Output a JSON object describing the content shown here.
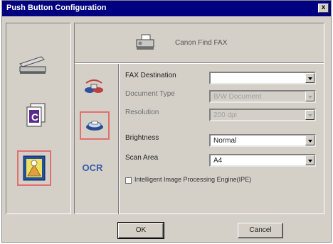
{
  "window": {
    "title": "Push Button Configuration",
    "close_label": "x"
  },
  "header": {
    "label": "Canon Find FAX",
    "icon": "fax-printer-icon"
  },
  "sidebar": {
    "items": [
      {
        "name": "scanner",
        "icon": "scanner-icon",
        "selected": false
      },
      {
        "name": "copy",
        "icon": "copy-document-icon",
        "selected": false
      },
      {
        "name": "photo",
        "icon": "photo-frame-icon",
        "selected": true
      }
    ]
  },
  "functions": {
    "items": [
      {
        "name": "email",
        "icon": "email-icon",
        "selected": false
      },
      {
        "name": "fax",
        "icon": "fax-icon",
        "selected": true
      },
      {
        "name": "ocr",
        "label": "OCR",
        "selected": false
      }
    ]
  },
  "form": {
    "fax_destination": {
      "label": "FAX Destination",
      "value": ""
    },
    "document_type": {
      "label": "Document Type",
      "value": "B/W Document",
      "disabled": true
    },
    "resolution": {
      "label": "Resolution",
      "value": "200 dpi",
      "disabled": true
    },
    "brightness": {
      "label": "Brightness",
      "value": "Normal"
    },
    "scan_area": {
      "label": "Scan Area",
      "value": "A4"
    },
    "ipe_checkbox": {
      "label": "Intelligent Image Processing Engine(IPE)",
      "checked": false
    }
  },
  "buttons": {
    "ok": "OK",
    "cancel": "Cancel"
  },
  "colors": {
    "titlebar": "#000080",
    "dialog": "#d4d0c8",
    "selection": "#e07070",
    "ocr": "#3a5ca8"
  }
}
